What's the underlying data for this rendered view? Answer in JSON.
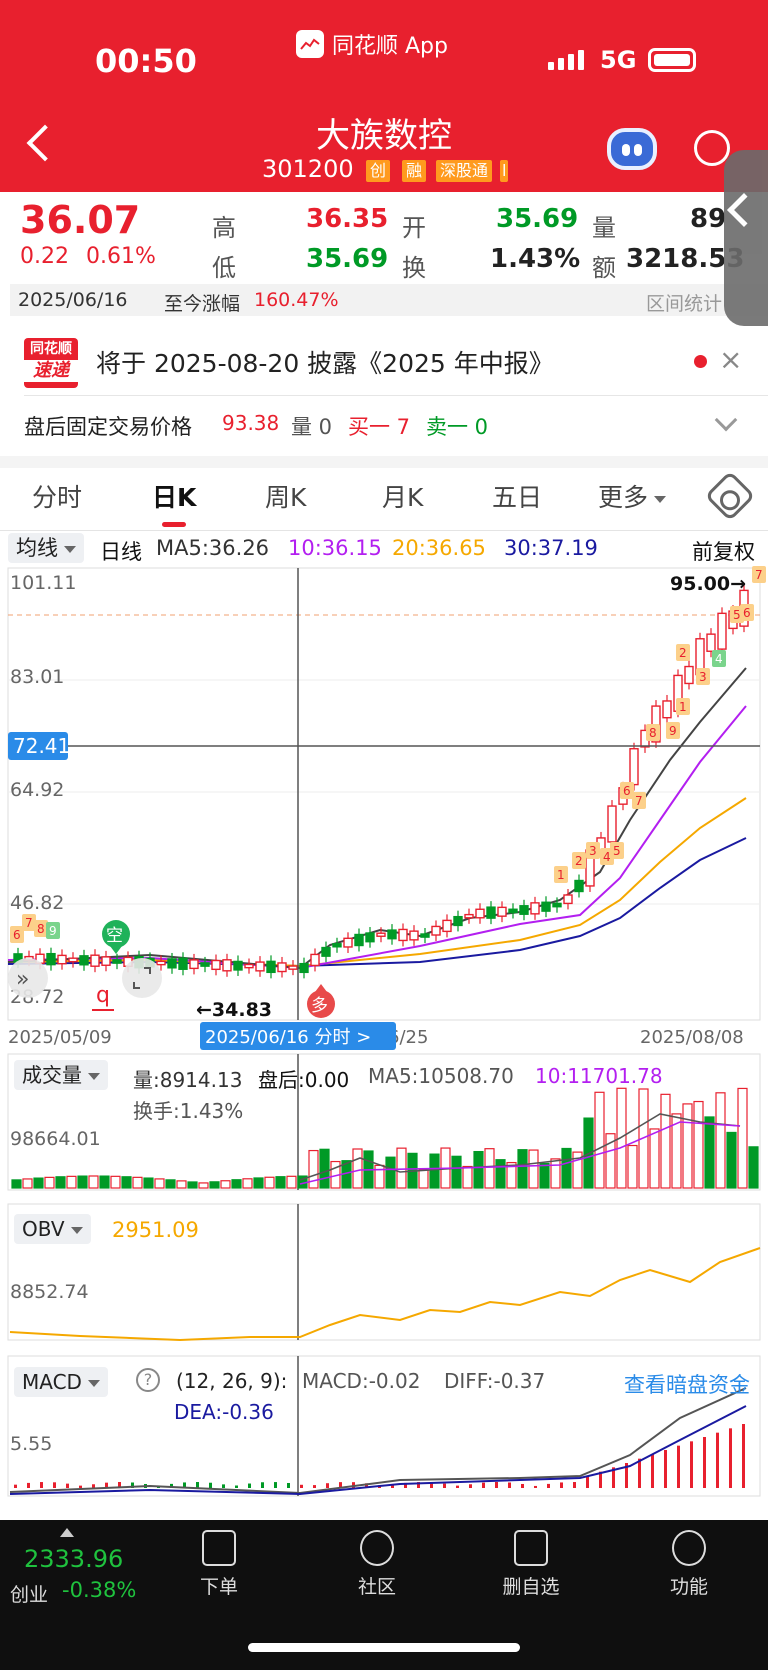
{
  "status": {
    "time": "00:50",
    "app": "同花顺 App",
    "network": "5G"
  },
  "stock": {
    "name": "大族数控",
    "code": "301200",
    "tags": [
      "创",
      "融",
      "深股通"
    ],
    "tags_tail": "l"
  },
  "quote": {
    "price": "36.07",
    "change": "0.22",
    "change_pct": "0.61%",
    "high_label": "高",
    "high": "36.35",
    "open_label": "开",
    "open": "35.69",
    "vol_label": "量",
    "vol": "89",
    "low_label": "低",
    "low": "35.69",
    "turn_label": "换",
    "turn": "1.43%",
    "amt_label": "额",
    "amt": "3218.53"
  },
  "datebar": {
    "date": "2025/06/16",
    "since_label": "至今涨幅",
    "since_value": "160.47%",
    "range_stats": "区间统计"
  },
  "notice": {
    "logo_top": "同花顺",
    "logo_bottom": "速递",
    "text": "将于 2025-08-20 披露《2025 年中报》",
    "close": "×"
  },
  "after_hours": {
    "label": "盘后固定交易价格",
    "price": "93.38",
    "qty": "量 0",
    "bid": "买一 7",
    "ask": "卖一 0"
  },
  "tabs": [
    "分时",
    "日K",
    "周K",
    "月K",
    "五日",
    "更多"
  ],
  "ma_bar": {
    "selector": "均线",
    "period": "日线",
    "ma5": "MA5:36.26",
    "ma10": "10:36.15",
    "ma20": "20:36.65",
    "ma30": "30:37.19",
    "adjust": "前复权"
  },
  "kline": {
    "y_labels": [
      "101.11",
      "83.01",
      "64.92",
      "46.82",
      "28.72"
    ],
    "cursor_price": "72.41",
    "max_marker": "95.00→",
    "min_marker": "←34.83",
    "date_left": "2025/05/09",
    "date_right": "2025/08/08",
    "cursor_date": "2025/06/16 分时 >",
    "cursor_date_tail": "6/25",
    "signal_empty": "空",
    "signal_long": "多",
    "signal_q": "q",
    "marker_nums": [
      "6",
      "7",
      "8",
      "9",
      "1",
      "2",
      "3",
      "4",
      "5",
      "6",
      "7",
      "8",
      "9",
      "1",
      "2",
      "3",
      "4",
      "5",
      "6",
      "7",
      "8"
    ]
  },
  "volume": {
    "selector": "成交量",
    "vol": "量:8914.13",
    "after": "盘后:0.00",
    "ma5": "MA5:10508.70",
    "ma10": "10:11701.78",
    "turnover": "换手:1.43%",
    "y_label": "98664.01"
  },
  "obv": {
    "selector": "OBV",
    "value": "2951.09",
    "y_label": "8852.74"
  },
  "macd": {
    "selector": "MACD",
    "help": "?",
    "params": "(12, 26, 9):",
    "macd": "MACD:-0.02",
    "diff": "DIFF:-0.37",
    "dea": "DEA:-0.36",
    "link": "查看暗盘资金",
    "y_label": "5.55"
  },
  "bottom": {
    "index_value": "2333.96",
    "index_name": "创业",
    "index_change": "-0.38%",
    "items": [
      "下单",
      "社区",
      "删自选",
      "功能"
    ]
  },
  "colors": {
    "up": "#e8202e",
    "down": "#009a26",
    "ma5": "#333333",
    "ma10": "#b31ff0",
    "ma20": "#f5a800",
    "ma30": "#1a1aa0",
    "obv": "#f5a800"
  }
}
